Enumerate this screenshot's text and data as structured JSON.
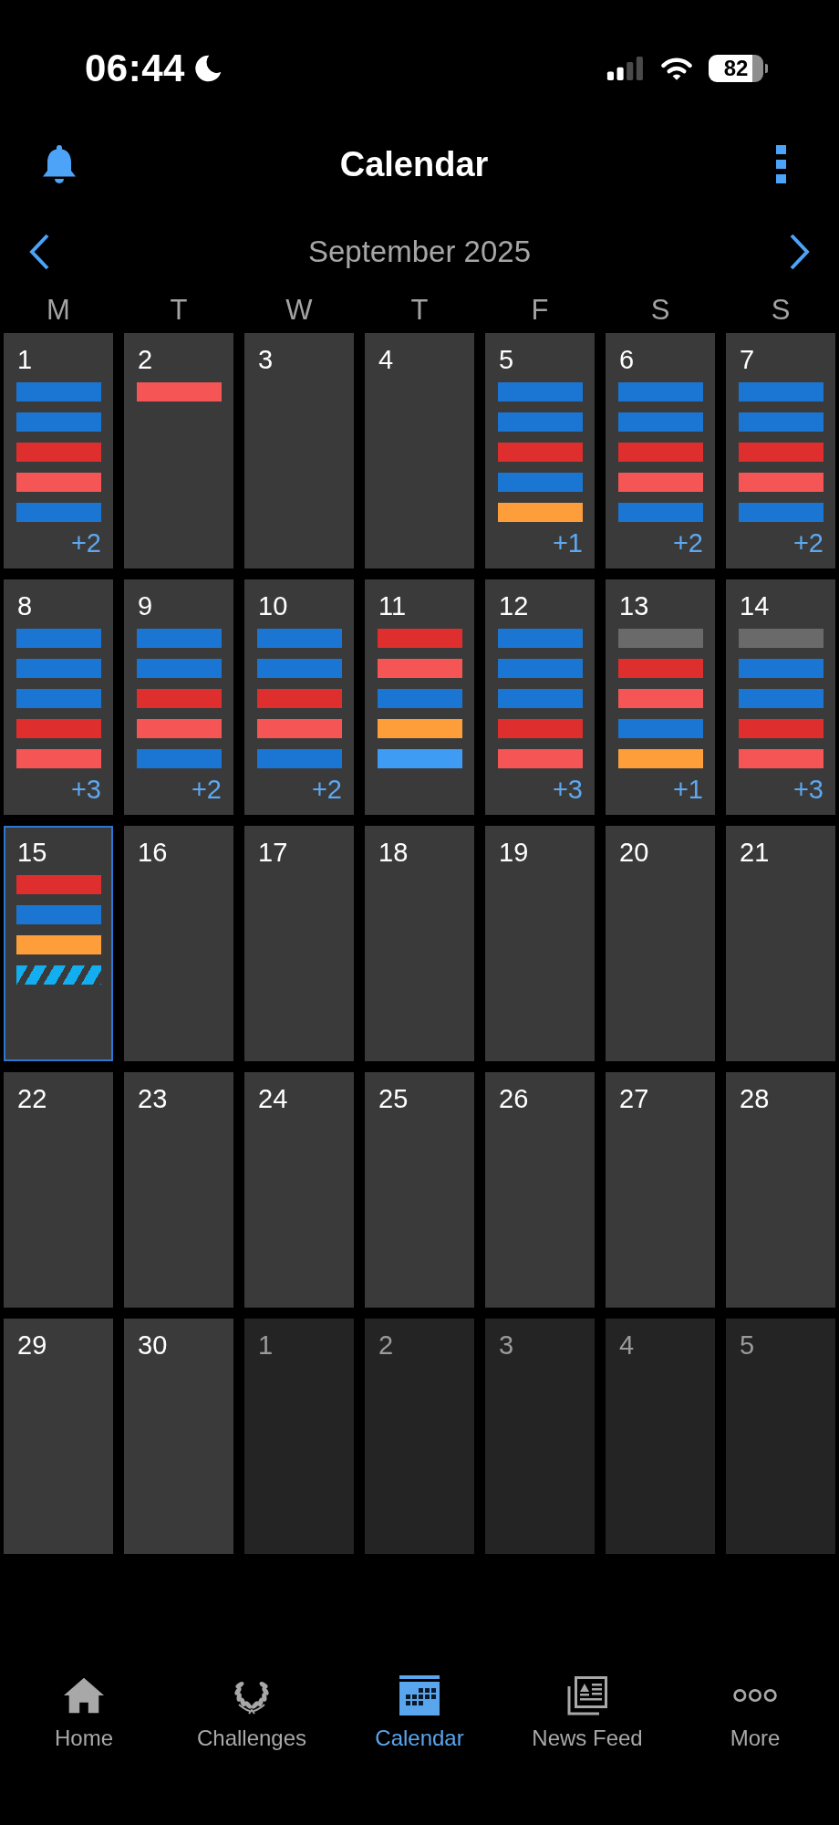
{
  "status_bar": {
    "time": "06:44",
    "battery": "82"
  },
  "header": {
    "title": "Calendar"
  },
  "month_nav": {
    "label": "September 2025"
  },
  "weekdays": [
    "M",
    "T",
    "W",
    "T",
    "F",
    "S",
    "S"
  ],
  "weeks": [
    [
      {
        "day": "1",
        "in_month": true,
        "selected": false,
        "events": [
          {
            "kind": "solid",
            "color": "#1b76d3"
          },
          {
            "kind": "solid",
            "color": "#1b76d3"
          },
          {
            "kind": "solid",
            "color": "#df2e2e"
          },
          {
            "kind": "solid",
            "color": "#f65555"
          },
          {
            "kind": "solid",
            "color": "#1b76d3"
          }
        ],
        "more": "+2"
      },
      {
        "day": "2",
        "in_month": true,
        "selected": false,
        "events": [
          {
            "kind": "solid",
            "color": "#f65555"
          }
        ]
      },
      {
        "day": "3",
        "in_month": true,
        "selected": false
      },
      {
        "day": "4",
        "in_month": true,
        "selected": false
      },
      {
        "day": "5",
        "in_month": true,
        "selected": false,
        "events": [
          {
            "kind": "solid",
            "color": "#1b76d3"
          },
          {
            "kind": "solid",
            "color": "#1b76d3"
          },
          {
            "kind": "solid",
            "color": "#df2e2e"
          },
          {
            "kind": "solid",
            "color": "#1b76d3"
          },
          {
            "kind": "solid",
            "color": "#fd9e3a"
          }
        ],
        "more": "+1"
      },
      {
        "day": "6",
        "in_month": true,
        "selected": false,
        "events": [
          {
            "kind": "solid",
            "color": "#1b76d3"
          },
          {
            "kind": "solid",
            "color": "#1b76d3"
          },
          {
            "kind": "solid",
            "color": "#df2e2e"
          },
          {
            "kind": "solid",
            "color": "#f65555"
          },
          {
            "kind": "solid",
            "color": "#1b76d3"
          }
        ],
        "more": "+2"
      },
      {
        "day": "7",
        "in_month": true,
        "selected": false,
        "events": [
          {
            "kind": "solid",
            "color": "#1b76d3"
          },
          {
            "kind": "solid",
            "color": "#1b76d3"
          },
          {
            "kind": "solid",
            "color": "#df2e2e"
          },
          {
            "kind": "solid",
            "color": "#f65555"
          },
          {
            "kind": "solid",
            "color": "#1b76d3"
          }
        ],
        "more": "+2"
      }
    ],
    [
      {
        "day": "8",
        "in_month": true,
        "selected": false,
        "events": [
          {
            "kind": "solid",
            "color": "#1b76d3"
          },
          {
            "kind": "solid",
            "color": "#1b76d3"
          },
          {
            "kind": "solid",
            "color": "#1b76d3"
          },
          {
            "kind": "solid",
            "color": "#df2e2e"
          },
          {
            "kind": "solid",
            "color": "#f65555"
          }
        ],
        "more": "+3"
      },
      {
        "day": "9",
        "in_month": true,
        "selected": false,
        "events": [
          {
            "kind": "solid",
            "color": "#1b76d3"
          },
          {
            "kind": "solid",
            "color": "#1b76d3"
          },
          {
            "kind": "solid",
            "color": "#df2e2e"
          },
          {
            "kind": "solid",
            "color": "#f65555"
          },
          {
            "kind": "solid",
            "color": "#1b76d3"
          }
        ],
        "more": "+2"
      },
      {
        "day": "10",
        "in_month": true,
        "selected": false,
        "events": [
          {
            "kind": "solid",
            "color": "#1b76d3"
          },
          {
            "kind": "solid",
            "color": "#1b76d3"
          },
          {
            "kind": "solid",
            "color": "#df2e2e"
          },
          {
            "kind": "solid",
            "color": "#f65555"
          },
          {
            "kind": "solid",
            "color": "#1b76d3"
          }
        ],
        "more": "+2"
      },
      {
        "day": "11",
        "in_month": true,
        "selected": false,
        "events": [
          {
            "kind": "solid",
            "color": "#df2e2e"
          },
          {
            "kind": "solid",
            "color": "#f65555"
          },
          {
            "kind": "solid",
            "color": "#1b76d3"
          },
          {
            "kind": "solid",
            "color": "#fd9e3a"
          },
          {
            "kind": "solid",
            "color": "#3e9cf5"
          }
        ]
      },
      {
        "day": "12",
        "in_month": true,
        "selected": false,
        "events": [
          {
            "kind": "solid",
            "color": "#1b76d3"
          },
          {
            "kind": "solid",
            "color": "#1b76d3"
          },
          {
            "kind": "solid",
            "color": "#1b76d3"
          },
          {
            "kind": "solid",
            "color": "#df2e2e"
          },
          {
            "kind": "solid",
            "color": "#f65555"
          }
        ],
        "more": "+3"
      },
      {
        "day": "13",
        "in_month": true,
        "selected": false,
        "events": [
          {
            "kind": "solid",
            "color": "#6a6a6a"
          },
          {
            "kind": "solid",
            "color": "#df2e2e"
          },
          {
            "kind": "solid",
            "color": "#f65555"
          },
          {
            "kind": "solid",
            "color": "#1b76d3"
          },
          {
            "kind": "solid",
            "color": "#fd9e3a"
          }
        ],
        "more": "+1"
      },
      {
        "day": "14",
        "in_month": true,
        "selected": false,
        "events": [
          {
            "kind": "solid",
            "color": "#6a6a6a"
          },
          {
            "kind": "solid",
            "color": "#1b76d3"
          },
          {
            "kind": "solid",
            "color": "#1b76d3"
          },
          {
            "kind": "solid",
            "color": "#df2e2e"
          },
          {
            "kind": "solid",
            "color": "#f65555"
          }
        ],
        "more": "+3"
      }
    ],
    [
      {
        "day": "15",
        "in_month": true,
        "selected": true,
        "events": [
          {
            "kind": "solid",
            "color": "#df2e2e"
          },
          {
            "kind": "solid",
            "color": "#1b76d3"
          },
          {
            "kind": "solid",
            "color": "#fd9e3a"
          },
          {
            "kind": "striped",
            "color": "#13aef0"
          }
        ]
      },
      {
        "day": "16",
        "in_month": true,
        "selected": false
      },
      {
        "day": "17",
        "in_month": true,
        "selected": false
      },
      {
        "day": "18",
        "in_month": true,
        "selected": false
      },
      {
        "day": "19",
        "in_month": true,
        "selected": false
      },
      {
        "day": "20",
        "in_month": true,
        "selected": false
      },
      {
        "day": "21",
        "in_month": true,
        "selected": false
      }
    ],
    [
      {
        "day": "22",
        "in_month": true,
        "selected": false
      },
      {
        "day": "23",
        "in_month": true,
        "selected": false
      },
      {
        "day": "24",
        "in_month": true,
        "selected": false
      },
      {
        "day": "25",
        "in_month": true,
        "selected": false
      },
      {
        "day": "26",
        "in_month": true,
        "selected": false
      },
      {
        "day": "27",
        "in_month": true,
        "selected": false
      },
      {
        "day": "28",
        "in_month": true,
        "selected": false
      }
    ],
    [
      {
        "day": "29",
        "in_month": true,
        "selected": false
      },
      {
        "day": "30",
        "in_month": true,
        "selected": false
      },
      {
        "day": "1",
        "in_month": false,
        "selected": false
      },
      {
        "day": "2",
        "in_month": false,
        "selected": false
      },
      {
        "day": "3",
        "in_month": false,
        "selected": false
      },
      {
        "day": "4",
        "in_month": false,
        "selected": false
      },
      {
        "day": "5",
        "in_month": false,
        "selected": false
      }
    ]
  ],
  "tab_bar": [
    {
      "label": "Home",
      "selected": false
    },
    {
      "label": "Challenges",
      "selected": false
    },
    {
      "label": "Calendar",
      "selected": true
    },
    {
      "label": "News Feed",
      "selected": false
    },
    {
      "label": "More",
      "selected": false
    }
  ]
}
